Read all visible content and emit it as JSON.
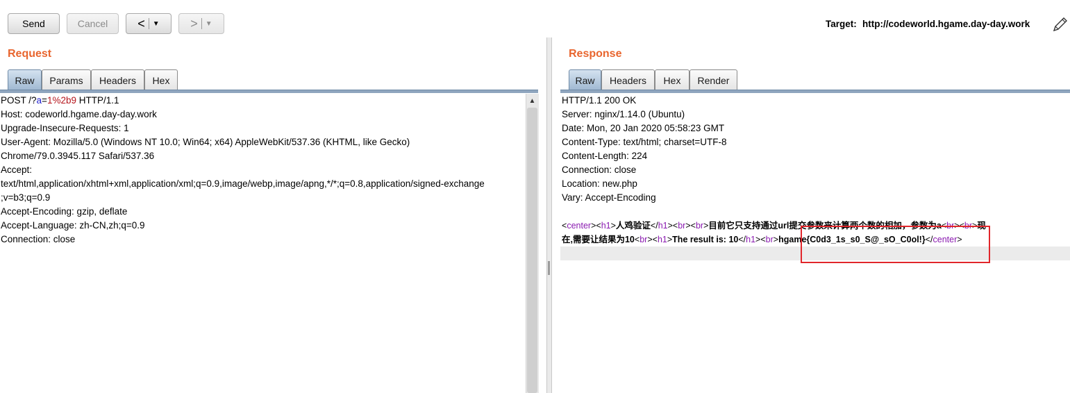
{
  "toolbar": {
    "send_label": "Send",
    "cancel_label": "Cancel",
    "back_glyph": "<",
    "forward_glyph": ">",
    "dropdown_glyph": "▼",
    "target_label": "Target:",
    "target_url": "http://codeworld.hgame.day-day.work",
    "edit_icon": "pencil-icon"
  },
  "request": {
    "title": "Request",
    "tabs": [
      "Raw",
      "Params",
      "Headers",
      "Hex"
    ],
    "active_tab": "Raw",
    "line1": {
      "method": "POST /?",
      "param": "a",
      "eq": "=",
      "value": "1%2b9",
      "rest": " HTTP/1.1"
    },
    "lines": [
      "Host: codeworld.hgame.day-day.work",
      "Upgrade-Insecure-Requests: 1",
      "User-Agent: Mozilla/5.0 (Windows NT 10.0; Win64; x64) AppleWebKit/537.36 (KHTML, like Gecko)",
      "Chrome/79.0.3945.117 Safari/537.36",
      "Accept:",
      "text/html,application/xhtml+xml,application/xml;q=0.9,image/webp,image/apng,*/*;q=0.8,application/signed-exchange",
      ";v=b3;q=0.9",
      "Accept-Encoding: gzip, deflate",
      "Accept-Language: zh-CN,zh;q=0.9",
      "Connection: close"
    ]
  },
  "response": {
    "title": "Response",
    "tabs": [
      "Raw",
      "Headers",
      "Hex",
      "Render"
    ],
    "active_tab": "Raw",
    "lines": [
      "HTTP/1.1 200 OK",
      "Server: nginx/1.14.0 (Ubuntu)",
      "Date: Mon, 20 Jan 2020 05:58:23 GMT",
      "Content-Type: text/html; charset=UTF-8",
      "Content-Length: 224",
      "Connection: close",
      "Location: new.php",
      "Vary: Accept-Encoding"
    ],
    "body": {
      "lt": "<",
      "gt": ">",
      "close_lt": "</",
      "tag_center": "center",
      "tag_h1": "h1",
      "tag_br": "br",
      "title_text": "人鸡验证",
      "desc_text": "目前它只支持通过url提交参数来计算两个数的相加，参数为a",
      "desc_text2": "现",
      "line2_start": "在,需要让结果为10",
      "result_text": "The result is: 10",
      "flag": "hgame{C0d3_1s_s0_S@_sO_C0ol!}"
    }
  },
  "colors": {
    "accent": "#e8652e",
    "highlight_box": "#e1262b",
    "tag": "#8a1ab0",
    "param": "#1f1fd1",
    "value": "#b5141b"
  }
}
